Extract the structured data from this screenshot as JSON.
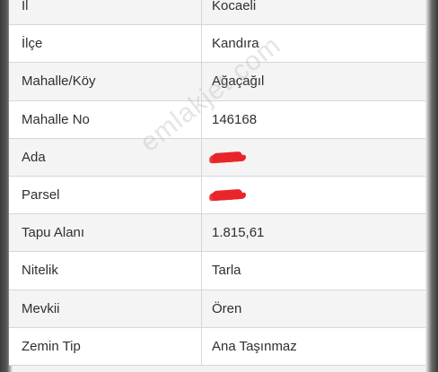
{
  "rows": [
    {
      "label": "İl",
      "value": "Kocaeli"
    },
    {
      "label": "İlçe",
      "value": "Kandıra"
    },
    {
      "label": "Mahalle/Köy",
      "value": "Ağaçağıl"
    },
    {
      "label": "Mahalle No",
      "value": "146168"
    },
    {
      "label": "Ada",
      "value": ""
    },
    {
      "label": "Parsel",
      "value": ""
    },
    {
      "label": "Tapu Alanı",
      "value": "1.815,61"
    },
    {
      "label": "Nitelik",
      "value": "Tarla"
    },
    {
      "label": "Mevkii",
      "value": "Ören"
    },
    {
      "label": "Zemin Tip",
      "value": "Ana Taşınmaz"
    }
  ],
  "watermark": "emlakjet.com",
  "colors": {
    "redaction": "#e8262a",
    "border": "#d6d6d6",
    "text": "#2f2f2f"
  }
}
